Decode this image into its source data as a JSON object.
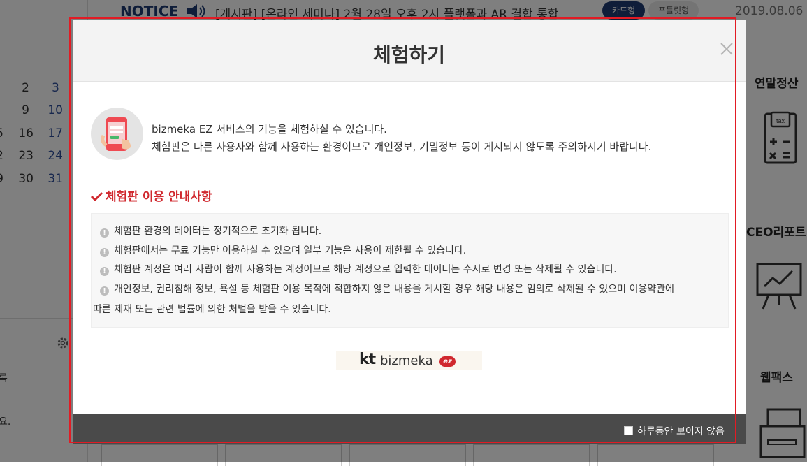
{
  "background": {
    "notice_title": "NOTICE",
    "notice_text": "[게시판] [온라인 세미나] 2월 28일 오후 2시  플랫폼과 AR 결합 통합",
    "view_card": "카드형",
    "view_portlet": "포틀릿형",
    "notice_date": "2019.08.06",
    "calendar": [
      [
        "2",
        "3"
      ],
      [
        "9",
        "10"
      ],
      [
        "5",
        "16",
        "17"
      ],
      [
        "2",
        "23",
        "24"
      ],
      [
        "9",
        "30",
        "31"
      ]
    ],
    "left_label_1": "록",
    "left_label_2": "요.",
    "side_items": [
      "연말정산",
      "CEO리포트",
      "웹팩스"
    ]
  },
  "modal": {
    "title": "체험하기",
    "intro_line_1": "bizmeka EZ 서비스의 기능을 체험하실 수 있습니다.",
    "intro_line_2": "체험판은 다른 사용자와 함께 사용하는 환경이므로 개인정보, 기밀정보 등이 게시되지 않도록 주의하시기 바랍니다.",
    "guide_heading": "체험판 이용 안내사항",
    "guide_items": [
      "체험판 환경의 데이터는 정기적으로 초기화 됩니다.",
      "체험판에서는 무료 기능만 이용하실 수 있으며 일부 기능은 사용이 제한될 수 있습니다.",
      "체험판 계정은 여러 사람이 함께 사용하는 계정이므로 해당 계정으로 입력한 데이터는 수시로 변경 또는 삭제될 수 있습니다.",
      "개인정보, 권리침해 정보, 욕설 등 체험판 이용 목적에 적합하지 않은 내용을 게시할 경우 해당 내용은 임의로 삭제될 수 있으며 이용약관에"
    ],
    "guide_item_4_cont": "따른 제재 또는 관련 법률에 의한 처벌을 받을 수 있습니다.",
    "logo_kt": "kt",
    "logo_bizmeka": "bizmeka",
    "logo_ez": "ez",
    "dont_show_today": "하루동안 보이지 않음"
  },
  "colors": {
    "accent_red": "#d0282e",
    "navy": "#1f3b72",
    "footer_bg": "#4a4a4a",
    "highlight": "#e21b24"
  }
}
